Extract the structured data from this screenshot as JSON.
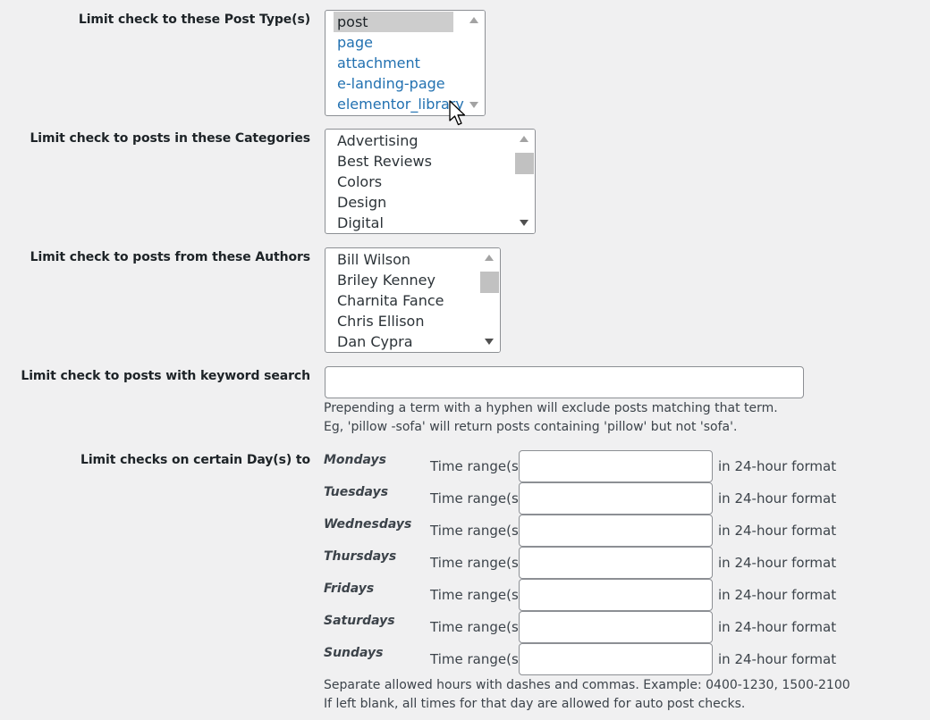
{
  "post_types": {
    "label": "Limit check to these Post Type(s)",
    "options": [
      "post",
      "page",
      "attachment",
      "e-landing-page",
      "elementor_library"
    ],
    "selected": "post"
  },
  "categories": {
    "label": "Limit check to posts in these Categories",
    "options": [
      "Advertising",
      "Best Reviews",
      "Colors",
      "Design",
      "Digital"
    ]
  },
  "authors": {
    "label": "Limit check to posts from these Authors",
    "options": [
      "Bill Wilson",
      "Briley Kenney",
      "Charnita Fance",
      "Chris Ellison",
      "Dan Cypra"
    ]
  },
  "keyword": {
    "label": "Limit check to posts with keyword search",
    "value": "",
    "help_line1": "Prepending a term with a hyphen will exclude posts matching that term.",
    "help_line2": "Eg, 'pillow -sofa' will return posts containing 'pillow' but not 'sofa'."
  },
  "days": {
    "label": "Limit checks on certain Day(s) to",
    "range_label": "Time range(s)",
    "suffix": "in 24-hour format",
    "items": [
      {
        "day": "Mondays",
        "value": ""
      },
      {
        "day": "Tuesdays",
        "value": ""
      },
      {
        "day": "Wednesdays",
        "value": ""
      },
      {
        "day": "Thursdays",
        "value": ""
      },
      {
        "day": "Fridays",
        "value": ""
      },
      {
        "day": "Saturdays",
        "value": ""
      },
      {
        "day": "Sundays",
        "value": ""
      }
    ],
    "help_line1": "Separate allowed hours with dashes and commas. Example: 0400-1230, 1500-2100",
    "help_line2": "If left blank, all times for that day are allowed for auto post checks."
  }
}
